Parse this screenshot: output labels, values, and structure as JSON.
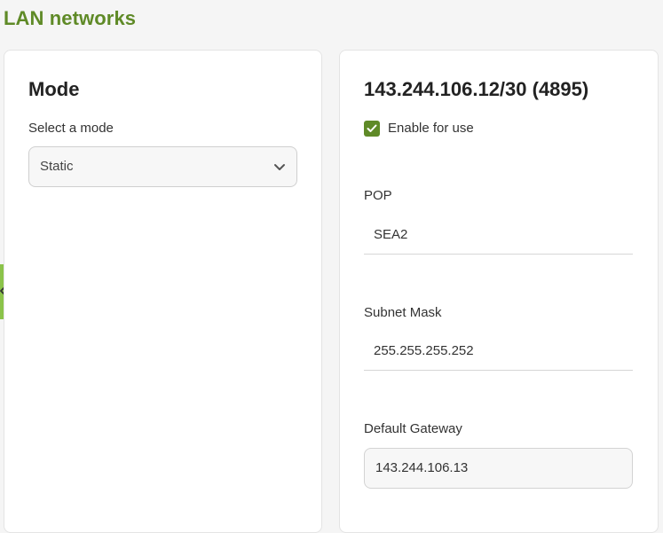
{
  "page": {
    "title": "LAN networks"
  },
  "mode_card": {
    "heading": "Mode",
    "select_label": "Select a mode",
    "select_value": "Static"
  },
  "network_card": {
    "heading": "143.244.106.12/30 (4895)",
    "enable_label": "Enable for use",
    "enable_checked": true,
    "pop_label": "POP",
    "pop_value": "SEA2",
    "subnet_label": "Subnet Mask",
    "subnet_value": "255.255.255.252",
    "gateway_label": "Default Gateway",
    "gateway_value": "143.244.106.13"
  },
  "colors": {
    "accent": "#5f8a27",
    "side_tab": "#8bc34a"
  },
  "icons": {
    "select_arrow": "chevron-down-icon",
    "side_tab": "chevron-left-icon",
    "checkbox": "check-icon"
  }
}
